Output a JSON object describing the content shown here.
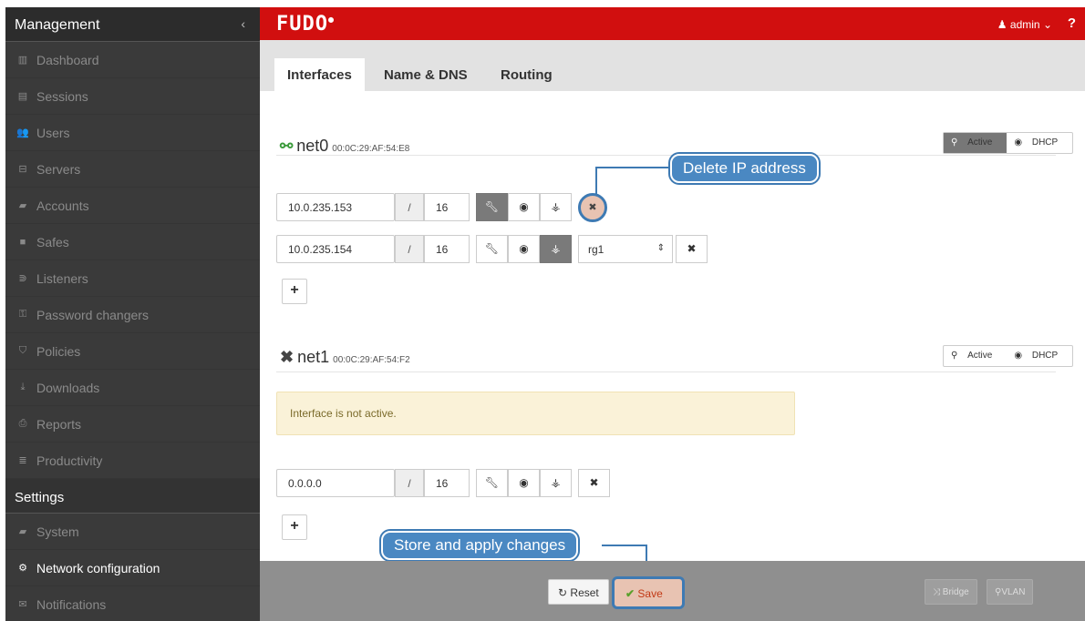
{
  "sidebar": {
    "title": "Management",
    "items": [
      {
        "icon": "dashboard-icon",
        "glyph": "▥",
        "label": "Dashboard"
      },
      {
        "icon": "sessions-icon",
        "glyph": "▤",
        "label": "Sessions"
      },
      {
        "icon": "users-icon",
        "glyph": "👥",
        "label": "Users"
      },
      {
        "icon": "servers-icon",
        "glyph": "⊟",
        "label": "Servers"
      },
      {
        "icon": "accounts-icon",
        "glyph": "▰",
        "label": "Accounts"
      },
      {
        "icon": "safes-icon",
        "glyph": "■",
        "label": "Safes"
      },
      {
        "icon": "listeners-icon",
        "glyph": "⋑",
        "label": "Listeners"
      },
      {
        "icon": "password-changers-icon",
        "glyph": "⚿",
        "label": "Password changers"
      },
      {
        "icon": "policies-icon",
        "glyph": "⛉",
        "label": "Policies"
      },
      {
        "icon": "downloads-icon",
        "glyph": "⤓",
        "label": "Downloads"
      },
      {
        "icon": "reports-icon",
        "glyph": "⎙",
        "label": "Reports"
      },
      {
        "icon": "productivity-icon",
        "glyph": "≣",
        "label": "Productivity"
      }
    ],
    "settings_title": "Settings",
    "settings_items": [
      {
        "icon": "folder-icon",
        "glyph": "▰",
        "label": "System"
      },
      {
        "icon": "network-config-icon",
        "glyph": "⚙",
        "label": "Network configuration",
        "active": true
      },
      {
        "icon": "envelope-icon",
        "glyph": "✉",
        "label": "Notifications"
      }
    ]
  },
  "topbar": {
    "logo": "FUDO",
    "user": "admin",
    "help": "?"
  },
  "tabs": [
    "Interfaces",
    "Name & DNS",
    "Routing"
  ],
  "interfaces": [
    {
      "name": "net0",
      "mac": "00:0C:29:AF:54:E8",
      "active_label": "Active",
      "dhcp_label": "DHCP",
      "addresses": [
        {
          "ip": "10.0.235.153",
          "slash": "/",
          "mask": "16"
        },
        {
          "ip": "10.0.235.154",
          "slash": "/",
          "mask": "16",
          "group": "rg1"
        }
      ]
    },
    {
      "name": "net1",
      "mac": "00:0C:29:AF:54:F2",
      "active_label": "Active",
      "dhcp_label": "DHCP",
      "warning": "Interface is not active.",
      "addresses": [
        {
          "ip": "0.0.0.0",
          "slash": "/",
          "mask": "16"
        }
      ]
    }
  ],
  "callouts": {
    "delete": "Delete IP address",
    "store": "Store and apply changes"
  },
  "footer": {
    "reset": "Reset",
    "save": "Save",
    "bridge": "Bridge",
    "vlan": "VLAN"
  }
}
